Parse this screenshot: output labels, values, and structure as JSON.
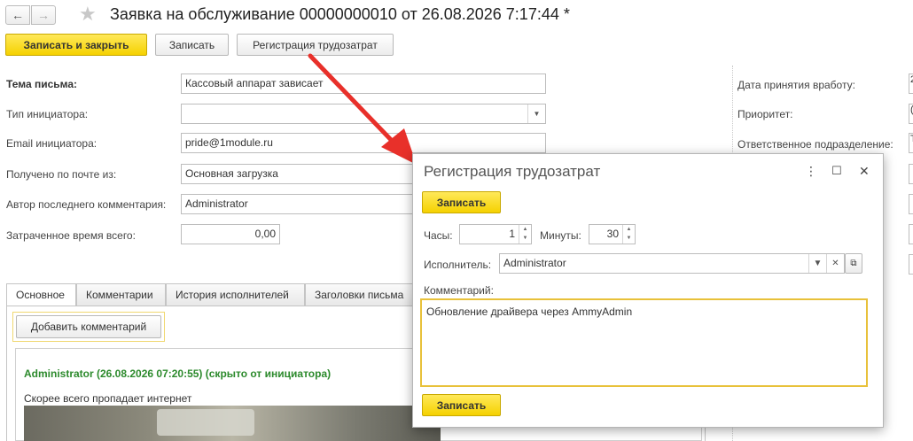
{
  "window": {
    "title": "Заявка на обслуживание 00000000010 от 26.08.2026 7:17:44 *",
    "nav_back": "←",
    "nav_forward": "→",
    "favorite_glyph": "★"
  },
  "toolbar": {
    "save_close": "Записать и закрыть",
    "save": "Записать",
    "register_labor": "Регистрация трудозатрат"
  },
  "form": {
    "subject_label": "Тема письма:",
    "subject_value": "Кассовый аппарат зависает",
    "initiator_type_label": "Тип инициатора:",
    "initiator_type_value": "",
    "email_label": "Email инициатора:",
    "email_value": "pride@1module.ru",
    "received_label": "Получено по почте из:",
    "received_value": "Основная загрузка",
    "last_author_label": "Автор последнего комментария:",
    "last_author_value": "Administrator",
    "total_time_label": "Затраченное время всего:",
    "total_time_value": "0,00"
  },
  "right_panel": {
    "accepted_date_label": "Дата принятия вработу:",
    "accepted_date_stub": "2",
    "priority_label": "Приоритет:",
    "priority_stub": "(",
    "department_label": "Ответственное подразделение:",
    "department_stub": "T"
  },
  "tabs": [
    {
      "label": "Основное"
    },
    {
      "label": "Комментарии"
    },
    {
      "label": "История исполнителей"
    },
    {
      "label": "Заголовки письма"
    }
  ],
  "comments": {
    "add_button": "Добавить комментарий",
    "author_line": "Administrator (26.08.2026 07:20:55) (скрыто от инициатора)",
    "text": "Скорее всего пропадает интернет"
  },
  "dialog": {
    "title": "Регистрация трудозатрат",
    "menu_glyph": "⋮",
    "maximize_glyph": "☐",
    "close_glyph": "✕",
    "save_top": "Записать",
    "hours_label": "Часы:",
    "hours_value": "1",
    "minutes_label": "Минуты:",
    "minutes_value": "30",
    "executor_label": "Исполнитель:",
    "executor_value": "Administrator",
    "comment_label": "Комментарий:",
    "comment_value": "Обновление драйвера через AmmyAdmin",
    "save_bottom": "Записать"
  },
  "colors": {
    "accent_yellow": "#f5d100",
    "annotation_red": "#e8302a",
    "comment_green": "#2c8a2c"
  }
}
